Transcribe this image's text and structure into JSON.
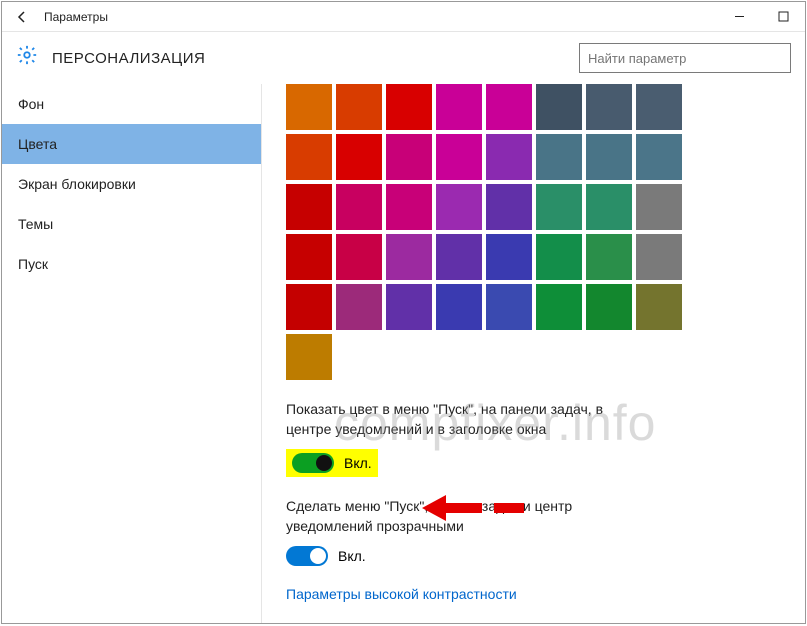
{
  "window": {
    "title": "Параметры"
  },
  "header": {
    "section_title": "ПЕРСОНАЛИЗАЦИЯ",
    "search_placeholder": "Найти параметр"
  },
  "sidebar": {
    "items": [
      {
        "label": "Фон",
        "active": false
      },
      {
        "label": "Цвета",
        "active": true
      },
      {
        "label": "Экран блокировки",
        "active": false
      },
      {
        "label": "Темы",
        "active": false
      },
      {
        "label": "Пуск",
        "active": false
      }
    ]
  },
  "palette": {
    "colors": [
      "#d86800",
      "#d83c00",
      "#d80000",
      "#c90097",
      "#c90097",
      "#3f5163",
      "#485b6e",
      "#4a5d70",
      "#d83c00",
      "#d80000",
      "#c80078",
      "#c90097",
      "#8a2ab0",
      "#497487",
      "#497487",
      "#4b7589",
      "#c60000",
      "#c80060",
      "#c80078",
      "#9b2ab0",
      "#6130a8",
      "#2a8f68",
      "#2a8f68",
      "#7a7a7a",
      "#c60000",
      "#c80046",
      "#9c2aa0",
      "#6130a8",
      "#3a3ab0",
      "#138e4a",
      "#2a8f4a",
      "#7a7a7a",
      "#c40000",
      "#9c2a7a",
      "#6130a8",
      "#3a3ab0",
      "#3a4ab0",
      "#0e8e38",
      "#13872e",
      "#74742e",
      "#bd7c00"
    ]
  },
  "options": {
    "show_color": {
      "label": "Показать цвет в меню \"Пуск\", на панели задач, в центре уведомлений и в заголовке окна",
      "state_text": "Вкл."
    },
    "transparency": {
      "label": "Сделать меню \"Пуск\", панель задач и центр уведомлений прозрачными",
      "state_text": "Вкл."
    },
    "high_contrast_link": "Параметры высокой контрастности"
  },
  "watermark": "compfixer.info"
}
